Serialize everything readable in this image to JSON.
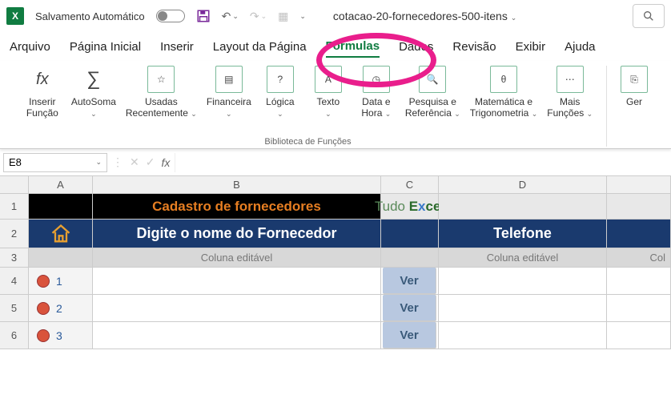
{
  "title_bar": {
    "autosave": "Salvamento Automático",
    "filename": "cotacao-20-fornecedores-500-itens",
    "filename_chev": "⌄"
  },
  "menu": {
    "arquivo": "Arquivo",
    "pagina_inicial": "Página Inicial",
    "inserir": "Inserir",
    "layout": "Layout da Página",
    "formulas": "Fórmulas",
    "dados": "Dados",
    "revisao": "Revisão",
    "exibir": "Exibir",
    "ajuda": "Ajuda"
  },
  "ribbon": {
    "inserir_funcao": "Inserir\nFunção",
    "autosoma": "AutoSoma",
    "usadas": "Usadas\nRecentemente",
    "financeira": "Financeira",
    "logica": "Lógica",
    "texto": "Texto",
    "data": "Data e\nHora",
    "pesquisa": "Pesquisa e\nReferência",
    "matematica": "Matemática e\nTrigonometria",
    "mais": "Mais\nFunções",
    "ger": "Ger",
    "group_label": "Biblioteca de Funções"
  },
  "namebox": "E8",
  "columns": {
    "A": "A",
    "B": "B",
    "C": "C",
    "D": "D"
  },
  "rows": {
    "1": "1",
    "2": "2",
    "3": "3",
    "4": "4",
    "5": "5",
    "6": "6"
  },
  "sheet": {
    "title": "Cadastro de fornecedores",
    "brand_pre": "Tudo ",
    "brand_e": "E",
    "brand_x": "x",
    "brand_post": "cel",
    "col_fornecedor": "Digite o nome do Fornecedor",
    "col_telefone": "Telefone",
    "hint": "Coluna editável",
    "hint2": "Col",
    "ver": "Ver",
    "n1": "1",
    "n2": "2",
    "n3": "3"
  }
}
